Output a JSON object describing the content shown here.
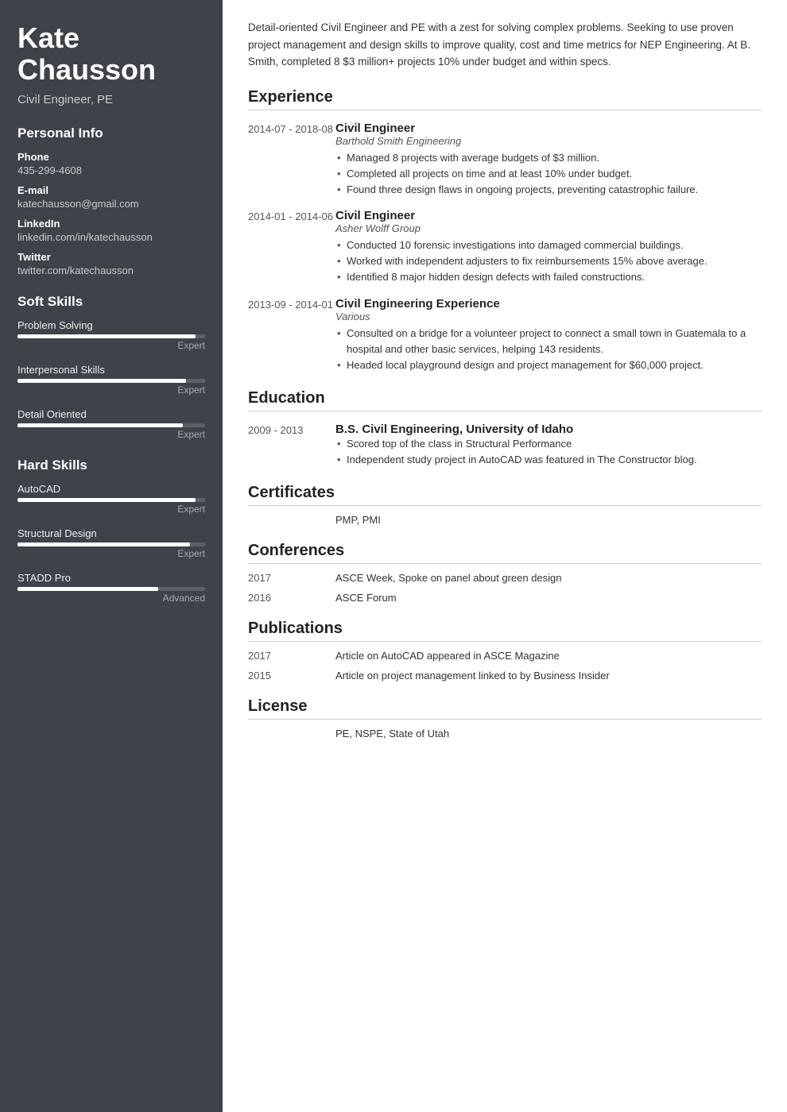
{
  "sidebar": {
    "name_line1": "Kate",
    "name_line2": "Chausson",
    "job_title": "Civil Engineer, PE",
    "personal_info_heading": "Personal Info",
    "phone_label": "Phone",
    "phone_value": "435-299-4608",
    "email_label": "E-mail",
    "email_value": "katechausson@gmail.com",
    "linkedin_label": "LinkedIn",
    "linkedin_value": "linkedin.com/in/katechausson",
    "twitter_label": "Twitter",
    "twitter_value": "twitter.com/katechausson",
    "soft_skills_heading": "Soft Skills",
    "soft_skills": [
      {
        "name": "Problem Solving",
        "level_label": "Expert",
        "fill_pct": 95
      },
      {
        "name": "Interpersonal Skills",
        "level_label": "Expert",
        "fill_pct": 90
      },
      {
        "name": "Detail Oriented",
        "level_label": "Expert",
        "fill_pct": 88
      }
    ],
    "hard_skills_heading": "Hard Skills",
    "hard_skills": [
      {
        "name": "AutoCAD",
        "level_label": "Expert",
        "fill_pct": 95
      },
      {
        "name": "Structural Design",
        "level_label": "Expert",
        "fill_pct": 92
      },
      {
        "name": "STADD Pro",
        "level_label": "Advanced",
        "fill_pct": 75
      }
    ]
  },
  "main": {
    "summary": "Detail-oriented Civil Engineer and PE with a zest for solving complex problems. Seeking to use proven project management and design skills to improve quality, cost and time metrics for NEP Engineering. At B. Smith, completed 8 $3 million+ projects 10% under budget and within specs.",
    "experience_heading": "Experience",
    "experience_entries": [
      {
        "date": "2014-07 - 2018-08",
        "role": "Civil Engineer",
        "company": "Barthold Smith Engineering",
        "bullets": [
          "Managed 8 projects with average budgets of $3 million.",
          "Completed all projects on time and at least 10% under budget.",
          "Found three design flaws in ongoing projects, preventing catastrophic failure."
        ]
      },
      {
        "date": "2014-01 - 2014-06",
        "role": "Civil Engineer",
        "company": "Asher Wolff Group",
        "bullets": [
          "Conducted 10 forensic investigations into damaged commercial buildings.",
          "Worked with independent adjusters to fix reimbursements 15% above average.",
          "Identified 8 major hidden design defects with failed constructions."
        ]
      },
      {
        "date": "2013-09 - 2014-01",
        "role": "Civil Engineering Experience",
        "company": "Various",
        "bullets": [
          "Consulted on a bridge for a volunteer project to connect a small town in Guatemala to a hospital and other basic services, helping 143 residents.",
          "Headed local playground design and project management for $60,000 project."
        ]
      }
    ],
    "education_heading": "Education",
    "education_entries": [
      {
        "date": "2009 - 2013",
        "role": "B.S. Civil Engineering, University of Idaho",
        "company": "",
        "bullets": [
          "Scored top of the class in Structural Performance",
          "Independent study project in AutoCAD was featured in The Constructor blog."
        ]
      }
    ],
    "certificates_heading": "Certificates",
    "certificates": [
      {
        "date": "",
        "text": "PMP, PMI"
      }
    ],
    "conferences_heading": "Conferences",
    "conferences": [
      {
        "date": "2017",
        "text": "ASCE Week, Spoke on panel about green design"
      },
      {
        "date": "2016",
        "text": "ASCE Forum"
      }
    ],
    "publications_heading": "Publications",
    "publications": [
      {
        "date": "2017",
        "text": "Article on AutoCAD appeared in ASCE Magazine"
      },
      {
        "date": "2015",
        "text": "Article on project management linked to by Business Insider"
      }
    ],
    "license_heading": "License",
    "license": [
      {
        "date": "",
        "text": "PE, NSPE, State of Utah"
      }
    ]
  }
}
